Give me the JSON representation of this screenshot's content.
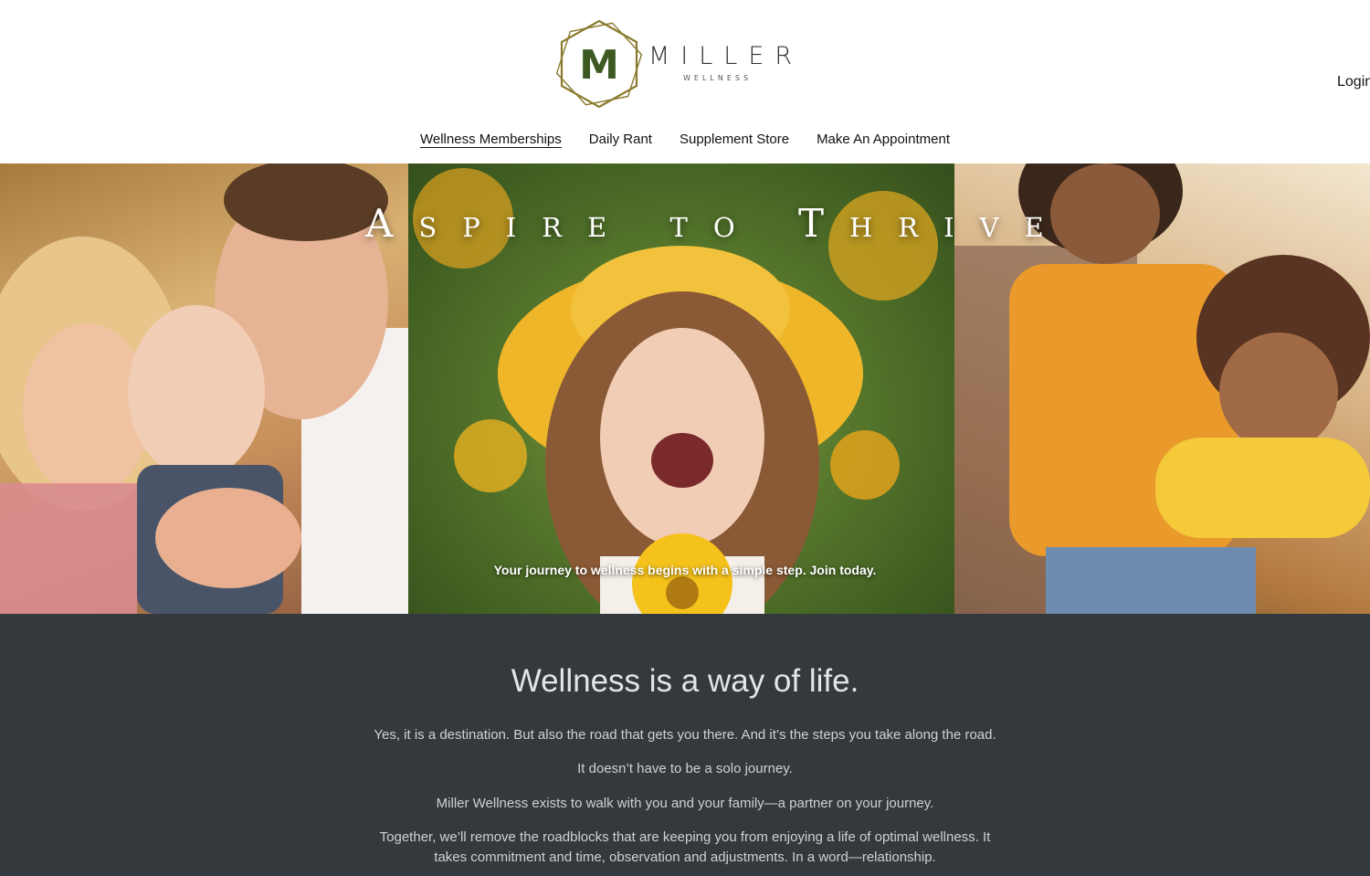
{
  "brand": {
    "logo_letter": "M",
    "name": "MILLER",
    "tagline": "WELLNESS",
    "logo_color": "#8a7a2e",
    "letter_color": "#3c5a22"
  },
  "header": {
    "login_label": "Login"
  },
  "nav": {
    "items": [
      {
        "label": "Wellness Memberships",
        "active": true
      },
      {
        "label": "Daily Rant",
        "active": false
      },
      {
        "label": "Supplement Store",
        "active": false
      },
      {
        "label": "Make An Appointment",
        "active": false
      }
    ]
  },
  "hero": {
    "title": "Aspire to Thrive",
    "caption": "Your journey to wellness begins with a simple step. Join today."
  },
  "intro": {
    "heading": "Wellness is a way of life.",
    "paragraphs": [
      "Yes, it is a destination. But also the road that gets you there. And it’s the steps you take along the road.",
      "It doesn’t have to be a solo journey.",
      "Miller Wellness exists to walk with you and your family—a partner on your journey.",
      "Together, we’ll remove the roadblocks that are keeping you from enjoying a life of optimal wellness. It takes commitment and time, observation and adjustments. In a word—relationship."
    ],
    "background": "#33393c"
  }
}
